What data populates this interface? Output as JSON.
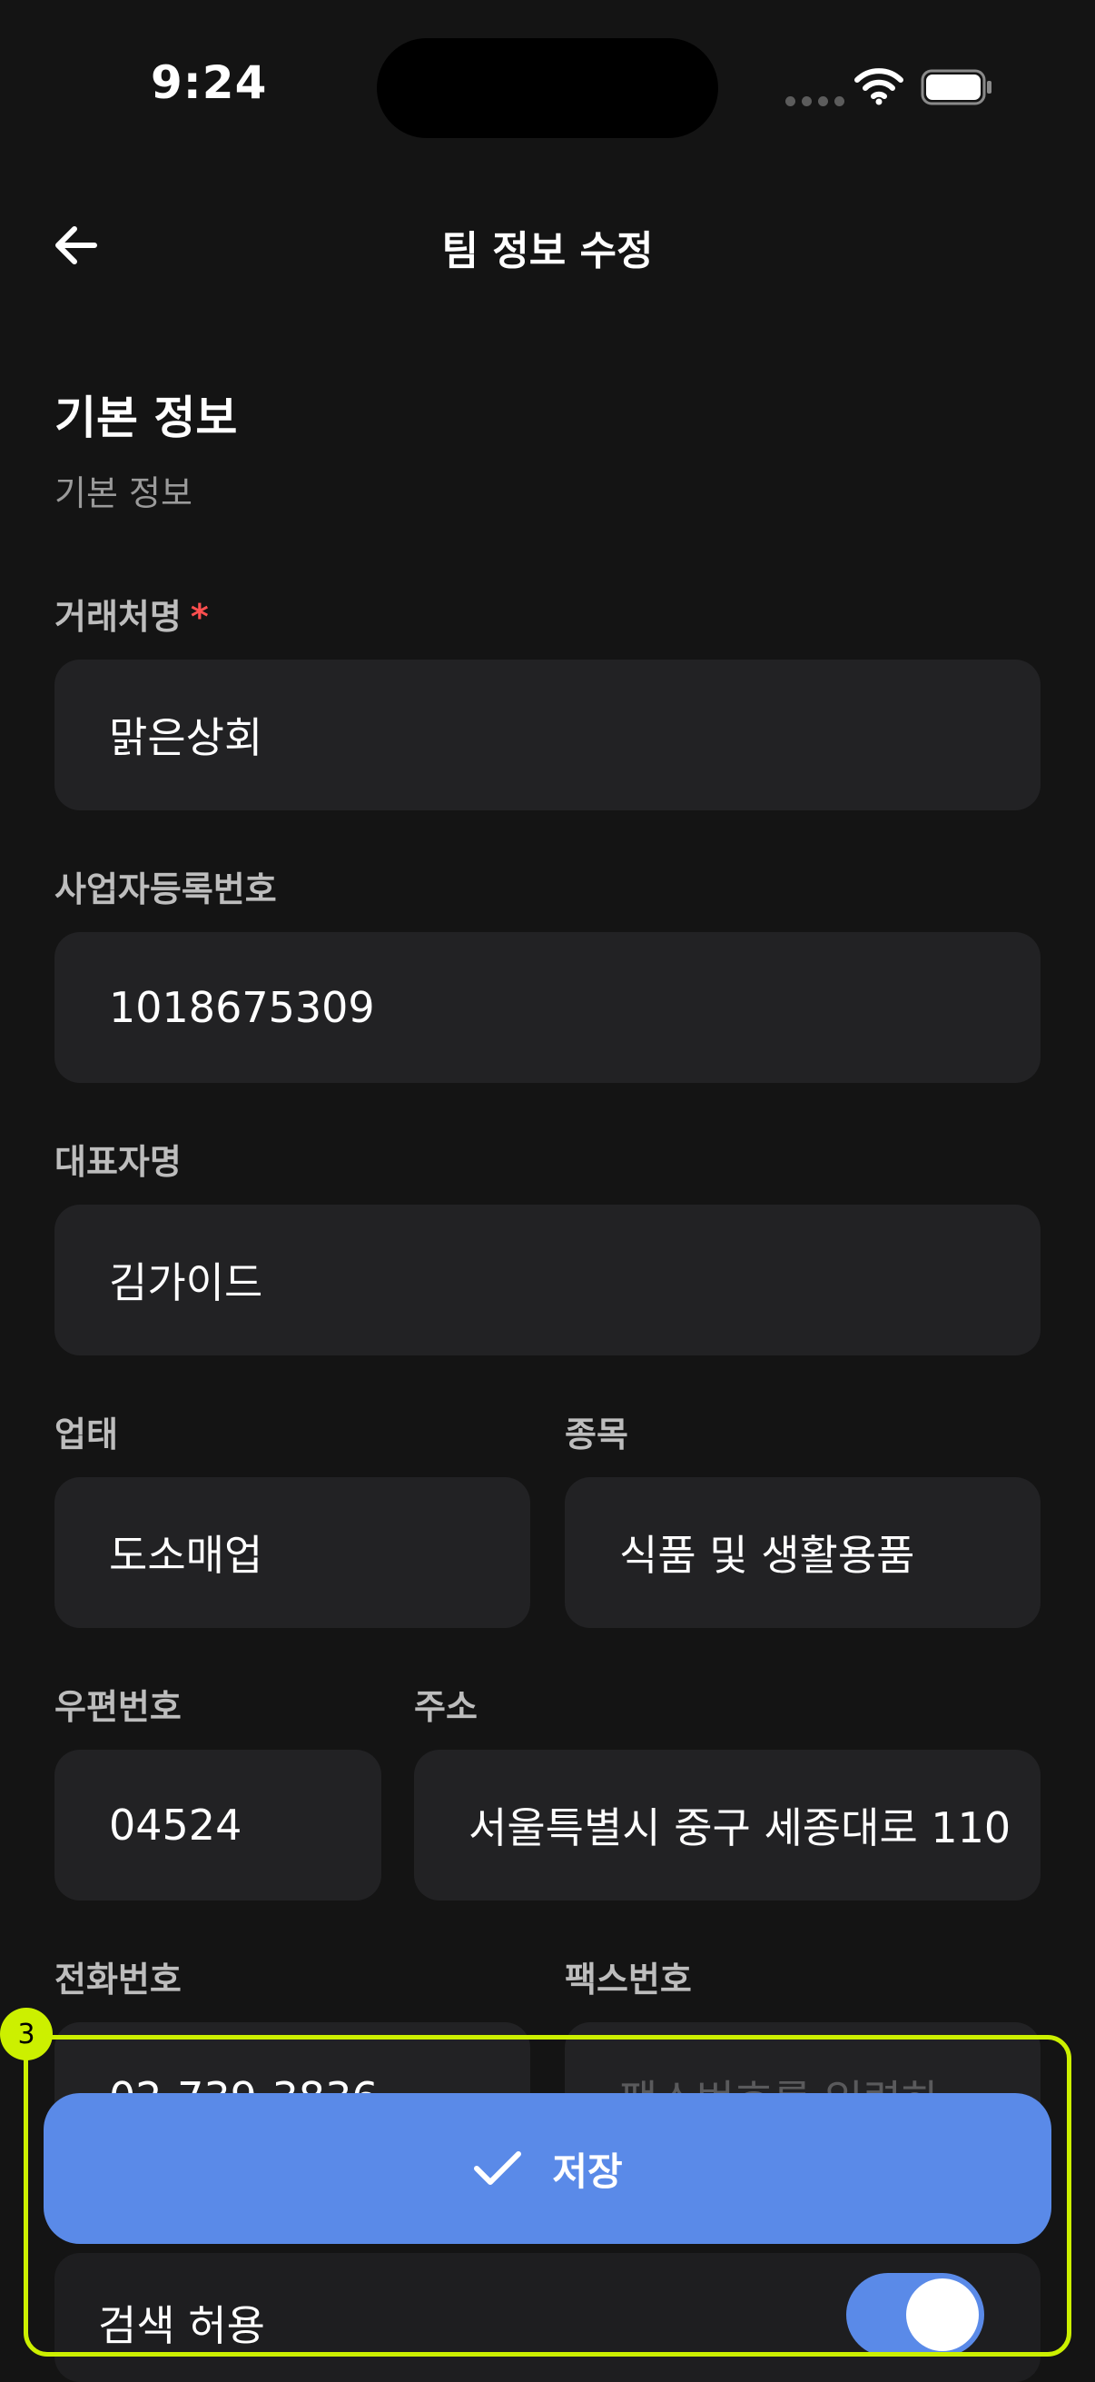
{
  "status_bar": {
    "time": "9:24"
  },
  "header": {
    "title": "팀 정보 수정",
    "back_icon": "arrow-left-icon"
  },
  "section": {
    "title": "기본 정보",
    "subtitle": "기본 정보"
  },
  "fields": {
    "company_name": {
      "label": "거래처명",
      "required_mark": "*",
      "value": "맑은상회"
    },
    "business_number": {
      "label": "사업자등록번호",
      "value": "1018675309"
    },
    "ceo_name": {
      "label": "대표자명",
      "value": "김가이드"
    },
    "business_type": {
      "label": "업태",
      "value": "도소매업"
    },
    "business_item": {
      "label": "종목",
      "value": "식품 및 생활용품"
    },
    "postal_code": {
      "label": "우편번호",
      "value": "04524"
    },
    "address": {
      "label": "주소",
      "value": "서울특별시 중구 세종대로 110"
    },
    "phone": {
      "label": "전화번호",
      "value": "02-739-3836"
    },
    "fax": {
      "label": "팩스번호",
      "placeholder": "팩스번호를 입력하"
    }
  },
  "highlight": {
    "number": "3"
  },
  "save_button": {
    "label": "저장",
    "icon": "check-icon"
  },
  "search_allow": {
    "label": "검색 허용",
    "enabled": true
  },
  "colors": {
    "accent": "#5a8ae8",
    "highlight": "#ccf000",
    "required": "#ff4f4f"
  }
}
